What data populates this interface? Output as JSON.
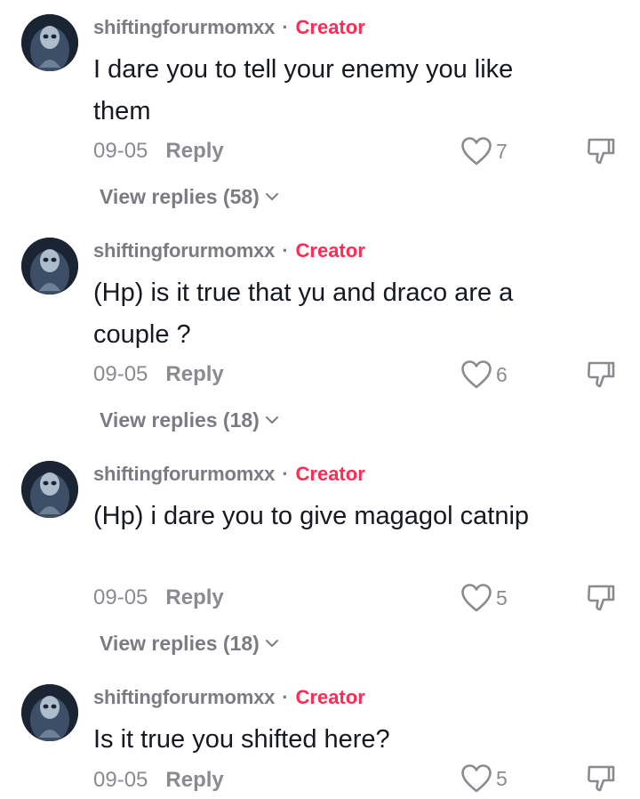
{
  "comments": [
    {
      "username": "shiftingforurmomxx",
      "separator": "·",
      "badge": "Creator",
      "text": "I dare you to tell your enemy you like them",
      "date": "09-05",
      "reply_label": "Reply",
      "likes": "7",
      "view_replies": "View replies (58)"
    },
    {
      "username": "shiftingforurmomxx",
      "separator": "·",
      "badge": "Creator",
      "text": "(Hp) is it true that yu and draco are a couple ?",
      "date": "09-05",
      "reply_label": "Reply",
      "likes": "6",
      "view_replies": "View replies (18)"
    },
    {
      "username": "shiftingforurmomxx",
      "separator": "·",
      "badge": "Creator",
      "text": "(Hp) i dare you to give magagol catnip",
      "date": "09-05",
      "reply_label": "Reply",
      "likes": "5",
      "view_replies": "View replies (18)"
    },
    {
      "username": "shiftingforurmomxx",
      "separator": "·",
      "badge": "Creator",
      "text": "Is it true you shifted here?",
      "date": "09-05",
      "reply_label": "Reply",
      "likes": "5"
    }
  ],
  "colors": {
    "creator_badge": "#fe2c55",
    "muted_text": "#8a8b91",
    "primary_text": "#161823"
  },
  "icons": {
    "like": "heart-outline-icon",
    "dislike": "thumbs-down-outline-icon",
    "expand": "chevron-down-icon"
  }
}
